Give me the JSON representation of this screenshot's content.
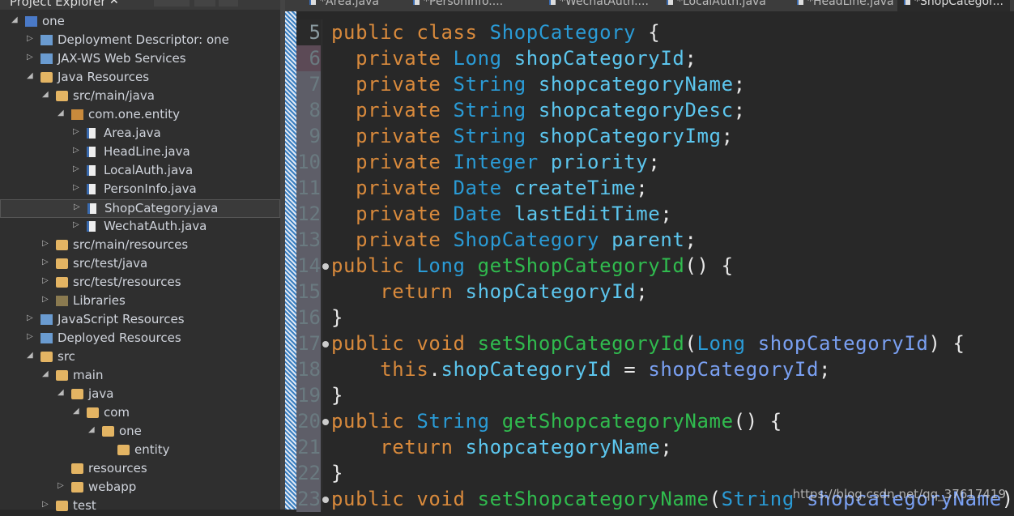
{
  "explorer": {
    "title": "Project Explorer",
    "close": "✕",
    "items": [
      {
        "level": 0,
        "toggle": "open",
        "icon": "proj",
        "label": "one"
      },
      {
        "level": 1,
        "toggle": "closed",
        "icon": "misc",
        "label": "Deployment Descriptor: one"
      },
      {
        "level": 1,
        "toggle": "closed",
        "icon": "misc",
        "label": "JAX-WS Web Services"
      },
      {
        "level": 1,
        "toggle": "open",
        "icon": "folder",
        "label": "Java Resources"
      },
      {
        "level": 2,
        "toggle": "open",
        "icon": "folder",
        "label": "src/main/java"
      },
      {
        "level": 3,
        "toggle": "open",
        "icon": "pkg",
        "label": "com.one.entity"
      },
      {
        "level": 4,
        "toggle": "closed",
        "icon": "java",
        "label": "Area.java"
      },
      {
        "level": 4,
        "toggle": "closed",
        "icon": "java",
        "label": "HeadLine.java"
      },
      {
        "level": 4,
        "toggle": "closed",
        "icon": "java",
        "label": "LocalAuth.java"
      },
      {
        "level": 4,
        "toggle": "closed",
        "icon": "java",
        "label": "PersonInfo.java"
      },
      {
        "level": 4,
        "toggle": "closed",
        "icon": "java",
        "label": "ShopCategory.java",
        "selected": true
      },
      {
        "level": 4,
        "toggle": "closed",
        "icon": "java",
        "label": "WechatAuth.java"
      },
      {
        "level": 2,
        "toggle": "closed",
        "icon": "folder",
        "label": "src/main/resources"
      },
      {
        "level": 2,
        "toggle": "closed",
        "icon": "folder",
        "label": "src/test/java"
      },
      {
        "level": 2,
        "toggle": "closed",
        "icon": "folder",
        "label": "src/test/resources"
      },
      {
        "level": 2,
        "toggle": "closed",
        "icon": "lib",
        "label": "Libraries"
      },
      {
        "level": 1,
        "toggle": "closed",
        "icon": "misc",
        "label": "JavaScript Resources"
      },
      {
        "level": 1,
        "toggle": "closed",
        "icon": "misc",
        "label": "Deployed Resources"
      },
      {
        "level": 1,
        "toggle": "open",
        "icon": "folder",
        "label": "src"
      },
      {
        "level": 2,
        "toggle": "open",
        "icon": "folder",
        "label": "main"
      },
      {
        "level": 3,
        "toggle": "open",
        "icon": "folder",
        "label": "java"
      },
      {
        "level": 4,
        "toggle": "open",
        "icon": "folder",
        "label": "com"
      },
      {
        "level": 5,
        "toggle": "open",
        "icon": "folder",
        "label": "one"
      },
      {
        "level": 6,
        "toggle": "none",
        "icon": "folder",
        "label": "entity"
      },
      {
        "level": 3,
        "toggle": "none",
        "icon": "folder",
        "label": "resources"
      },
      {
        "level": 3,
        "toggle": "closed",
        "icon": "folder",
        "label": "webapp"
      },
      {
        "level": 2,
        "toggle": "closed",
        "icon": "folder",
        "label": "test"
      }
    ]
  },
  "tabs": [
    {
      "label": "*Area.java"
    },
    {
      "label": "*PersonInfo...."
    },
    {
      "label": "*WechatAuth...."
    },
    {
      "label": "*LocalAuth.java"
    },
    {
      "label": "*HeadLine.java"
    },
    {
      "label": "*ShopCategor...",
      "active": true
    }
  ],
  "code": {
    "lines": [
      {
        "num": "5",
        "fold": false,
        "tokens": [
          [
            "public class ",
            "k"
          ],
          [
            "ShopCategory ",
            "t"
          ],
          [
            "{",
            "n"
          ]
        ]
      },
      {
        "num": "6",
        "fold": false,
        "tokens": [
          [
            "  private ",
            "k"
          ],
          [
            "Long ",
            "t"
          ],
          [
            "shopCategoryId",
            "f"
          ],
          [
            ";",
            "n"
          ]
        ]
      },
      {
        "num": "7",
        "fold": false,
        "tokens": [
          [
            "  private ",
            "k"
          ],
          [
            "String ",
            "t"
          ],
          [
            "shopcategoryName",
            "f"
          ],
          [
            ";",
            "n"
          ]
        ]
      },
      {
        "num": "8",
        "fold": false,
        "tokens": [
          [
            "  private ",
            "k"
          ],
          [
            "String ",
            "t"
          ],
          [
            "shopcategoryDesc",
            "f"
          ],
          [
            ";",
            "n"
          ]
        ]
      },
      {
        "num": "9",
        "fold": false,
        "tokens": [
          [
            "  private ",
            "k"
          ],
          [
            "String ",
            "t"
          ],
          [
            "shopCategoryImg",
            "f"
          ],
          [
            ";",
            "n"
          ]
        ]
      },
      {
        "num": "10",
        "fold": false,
        "tokens": [
          [
            "  private ",
            "k"
          ],
          [
            "Integer ",
            "t"
          ],
          [
            "priority",
            "f"
          ],
          [
            ";",
            "n"
          ]
        ]
      },
      {
        "num": "11",
        "fold": false,
        "tokens": [
          [
            "  private ",
            "k"
          ],
          [
            "Date ",
            "t"
          ],
          [
            "createTime",
            "f"
          ],
          [
            ";",
            "n"
          ]
        ]
      },
      {
        "num": "12",
        "fold": false,
        "tokens": [
          [
            "  private ",
            "k"
          ],
          [
            "Date ",
            "t"
          ],
          [
            "lastEditTime",
            "f"
          ],
          [
            ";",
            "n"
          ]
        ]
      },
      {
        "num": "13",
        "fold": false,
        "tokens": [
          [
            "  private ",
            "k"
          ],
          [
            "ShopCategory ",
            "t"
          ],
          [
            "parent",
            "f"
          ],
          [
            ";",
            "n"
          ]
        ]
      },
      {
        "num": "14",
        "fold": true,
        "tokens": [
          [
            "public ",
            "k"
          ],
          [
            "Long ",
            "t"
          ],
          [
            "getShopCategoryId",
            "m"
          ],
          [
            "() {",
            "n"
          ]
        ]
      },
      {
        "num": "15",
        "fold": false,
        "tokens": [
          [
            "    return ",
            "k"
          ],
          [
            "shopCategoryId",
            "f"
          ],
          [
            ";",
            "n"
          ]
        ]
      },
      {
        "num": "16",
        "fold": false,
        "tokens": [
          [
            "}",
            "n"
          ]
        ]
      },
      {
        "num": "17",
        "fold": true,
        "tokens": [
          [
            "public void ",
            "k"
          ],
          [
            "setShopCategoryId",
            "m"
          ],
          [
            "(",
            "n"
          ],
          [
            "Long ",
            "t"
          ],
          [
            "shopCategoryId",
            "p"
          ],
          [
            ") {",
            "n"
          ]
        ]
      },
      {
        "num": "18",
        "fold": false,
        "tokens": [
          [
            "    this",
            "k"
          ],
          [
            ".",
            "n"
          ],
          [
            "shopCategoryId",
            "f"
          ],
          [
            " = ",
            "n"
          ],
          [
            "shopCategoryId",
            "p"
          ],
          [
            ";",
            "n"
          ]
        ]
      },
      {
        "num": "19",
        "fold": false,
        "tokens": [
          [
            "}",
            "n"
          ]
        ]
      },
      {
        "num": "20",
        "fold": true,
        "tokens": [
          [
            "public ",
            "k"
          ],
          [
            "String ",
            "t"
          ],
          [
            "getShopcategoryName",
            "m"
          ],
          [
            "() {",
            "n"
          ]
        ]
      },
      {
        "num": "21",
        "fold": false,
        "tokens": [
          [
            "    return ",
            "k"
          ],
          [
            "shopcategoryName",
            "f"
          ],
          [
            ";",
            "n"
          ]
        ]
      },
      {
        "num": "22",
        "fold": false,
        "tokens": [
          [
            "}",
            "n"
          ]
        ]
      },
      {
        "num": "23",
        "fold": true,
        "tokens": [
          [
            "public void ",
            "k"
          ],
          [
            "setShopcategoryName",
            "m"
          ],
          [
            "(",
            "n"
          ],
          [
            "String ",
            "t"
          ],
          [
            "shopcategoryName",
            "p"
          ],
          [
            ")",
            "n"
          ]
        ]
      }
    ]
  },
  "watermark": "https://blog.csdn.net/qq_37617419",
  "colors": {
    "keyword": "#d98a3c",
    "type": "#2a9bd6",
    "field": "#5cc6ee",
    "method": "#30bb4e",
    "param": "#7aa0f2"
  }
}
